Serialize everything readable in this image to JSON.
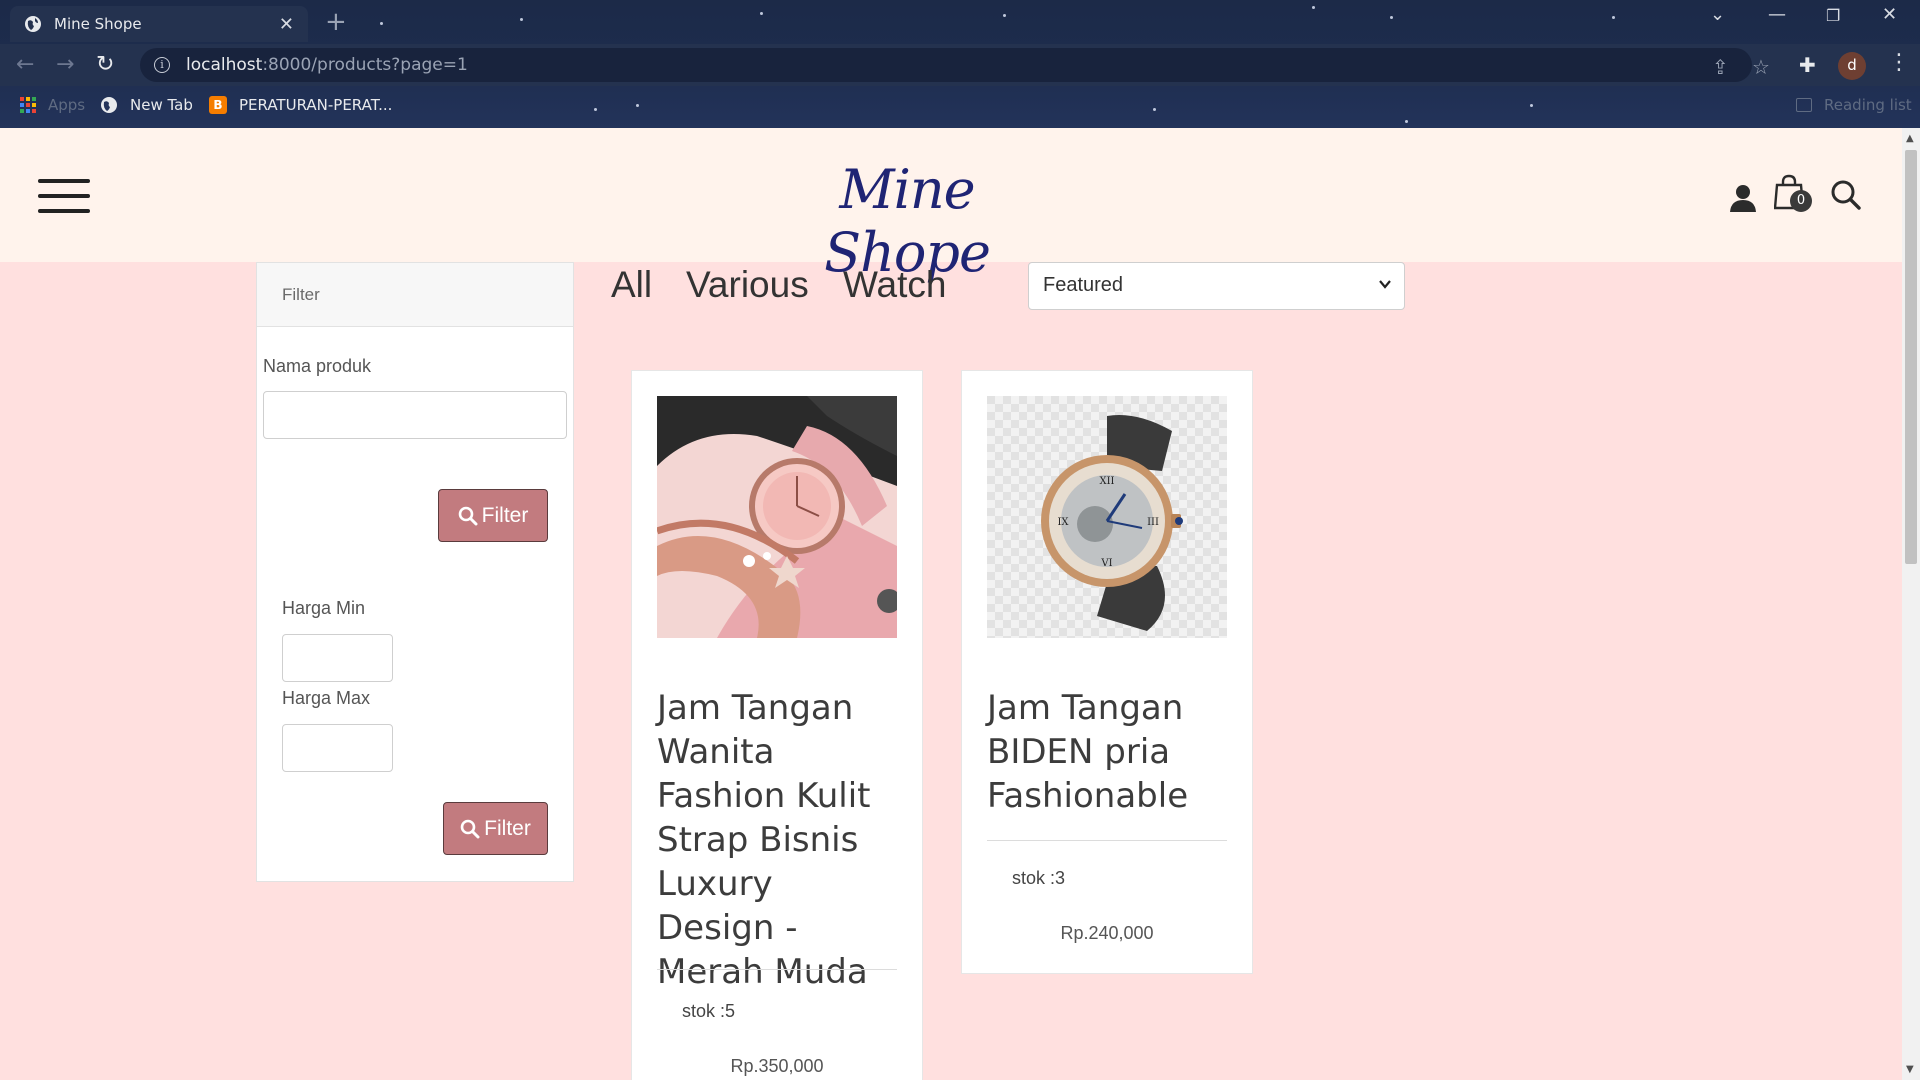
{
  "browser": {
    "tab_title": "Mine Shope",
    "url_host": "localhost",
    "url_path": ":8000/products?page=1",
    "profile_initial": "d",
    "bookmarks": [
      {
        "label": "Apps",
        "icon": "apps-grid-icon"
      },
      {
        "label": "New Tab",
        "icon": "globe-icon"
      },
      {
        "label": "PERATURAN-PERAT...",
        "icon": "blogger-icon"
      }
    ],
    "reading_list": "Reading list"
  },
  "header": {
    "logo": "Mine Shope",
    "cart_count": "0"
  },
  "sidebar": {
    "title": "Filter",
    "name_label": "Nama produk",
    "name_value": "",
    "filter_button": "Filter",
    "min_label": "Harga Min",
    "max_label": "Harga Max",
    "min_value": "",
    "max_value": "",
    "price_filter_button": "Filter"
  },
  "categories": [
    "All",
    "Various",
    "Watch"
  ],
  "sort": {
    "selected": "Featured"
  },
  "products": [
    {
      "name": "Jam Tangan Wanita Fashion Kulit Strap Bisnis Luxury Design - Merah Muda",
      "stock": "stok :5",
      "price": "Rp.350,000"
    },
    {
      "name": "Jam Tangan BIDEN pria Fashionable",
      "stock": "stok :3",
      "price": "Rp.240,000"
    }
  ],
  "colors": {
    "page_bg": "#ffe0df",
    "header_bg": "#fff3ec",
    "logo": "#1f2474",
    "button": "#c27b7f"
  }
}
